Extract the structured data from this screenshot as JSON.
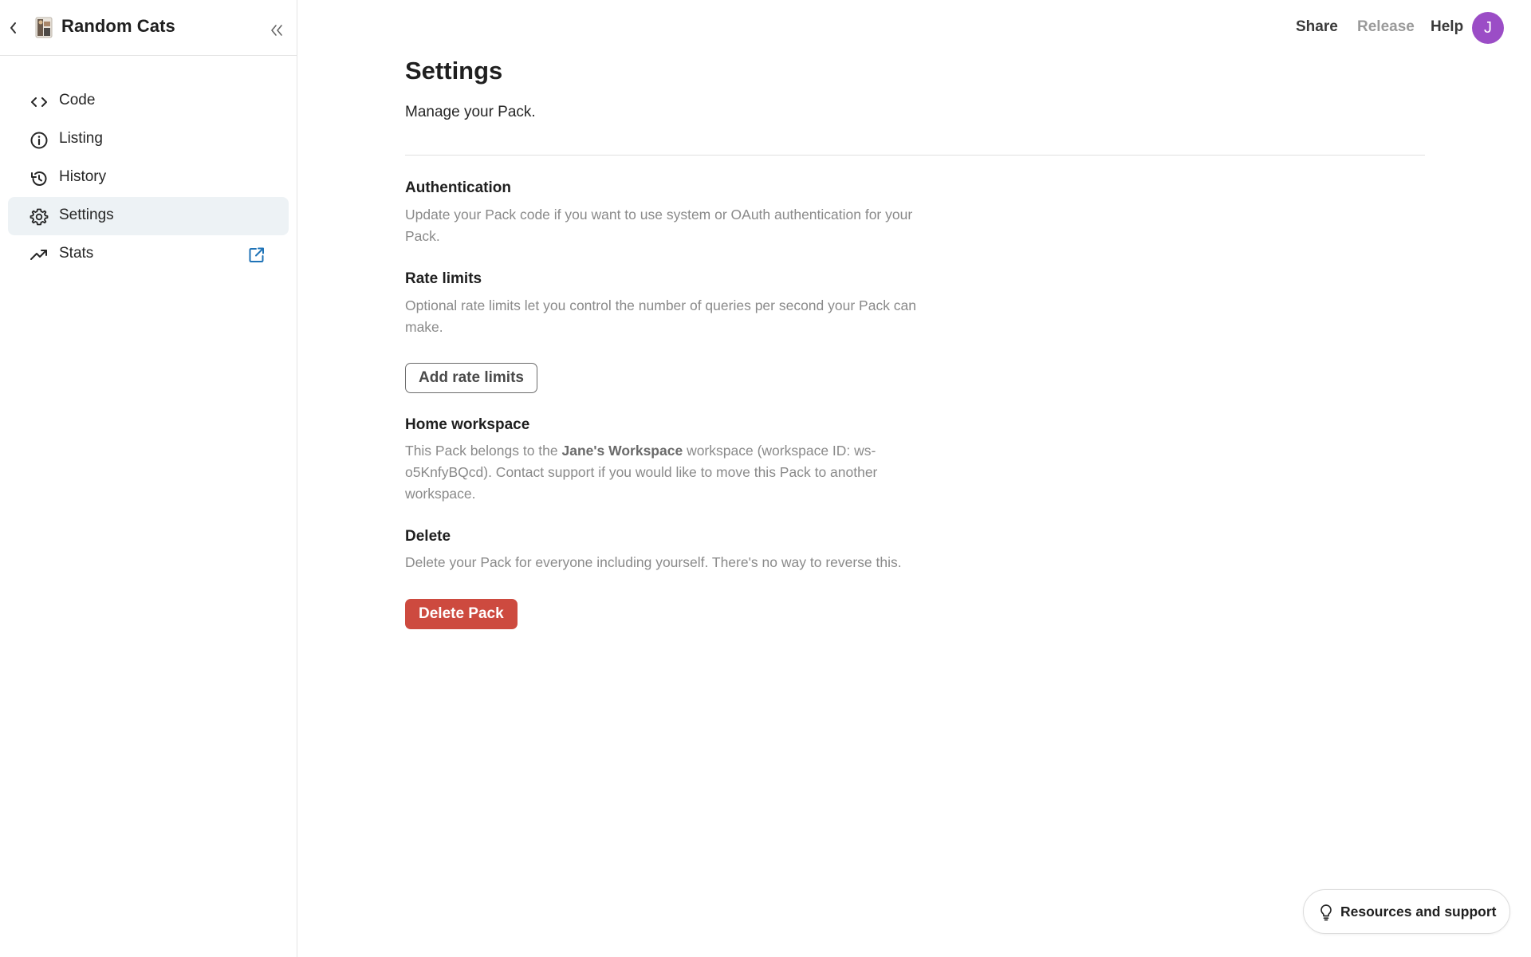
{
  "sidebar": {
    "back_icon": "chevron-left-icon",
    "pack_name": "Random Cats",
    "collapse_icon": "double-chevron-left-icon",
    "items": [
      {
        "label": "Code",
        "icon": "code-icon"
      },
      {
        "label": "Listing",
        "icon": "info-icon"
      },
      {
        "label": "History",
        "icon": "history-icon"
      },
      {
        "label": "Settings",
        "icon": "gear-icon",
        "active": true
      },
      {
        "label": "Stats",
        "icon": "trending-up-icon",
        "trailing_icon": "external-link-icon"
      }
    ]
  },
  "topbar": {
    "share_label": "Share",
    "release_label": "Release",
    "help_label": "Help",
    "avatar_initial": "J",
    "avatar_color": "#9b4dc6"
  },
  "main": {
    "title": "Settings",
    "subtitle": "Manage your Pack.",
    "sections": {
      "authentication": {
        "title": "Authentication",
        "description": "Update your Pack code if you want to use system or OAuth authentication for your Pack."
      },
      "rate_limits": {
        "title": "Rate limits",
        "description": "Optional rate limits let you control the number of queries per second your Pack can make.",
        "button_label": "Add rate limits"
      },
      "home_workspace": {
        "title": "Home workspace",
        "description_before": "This Pack belongs to the ",
        "workspace_name": "Jane's Workspace",
        "description_after": " workspace (workspace ID: ws-o5KnfyBQcd). Contact support if you would like to move this Pack to another workspace."
      },
      "delete": {
        "title": "Delete",
        "description": "Delete your Pack for everyone including yourself. There's no way to reverse this.",
        "button_label": "Delete Pack",
        "button_color": "#cd4a3f"
      }
    }
  },
  "resources": {
    "label": "Resources and support",
    "icon": "lightbulb-icon"
  }
}
